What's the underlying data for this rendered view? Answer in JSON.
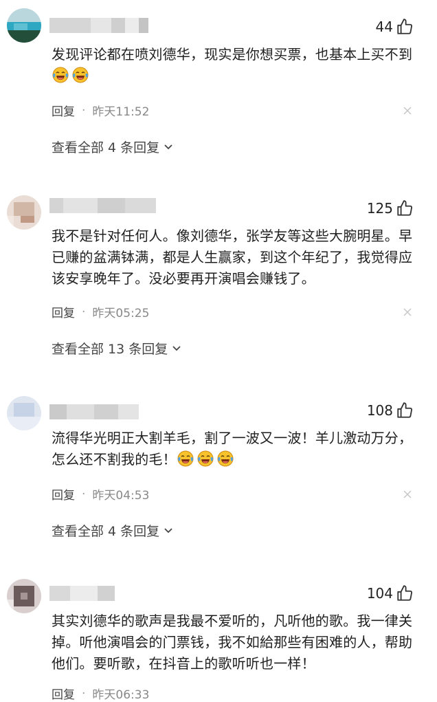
{
  "comments": [
    {
      "likes": "44",
      "text": "发现评论都在喷刘德华，现实是你想买票，也基本上买不到",
      "emoji_count": 2,
      "reply_label": "回复",
      "separator": "·",
      "time": "昨天11:52",
      "view_replies": "查看全部 4 条回复"
    },
    {
      "likes": "125",
      "text": "我不是针对任何人。像刘德华，张学友等这些大腕明星。早已赚的盆满钵满，都是人生赢家，到这个年纪了，我觉得应该安享晚年了。没必要再开演唱会赚钱了。",
      "emoji_count": 0,
      "reply_label": "回复",
      "separator": "·",
      "time": "昨天05:25",
      "view_replies": "查看全部 13 条回复"
    },
    {
      "likes": "108",
      "text": "流得华光明正大割羊毛，割了一波又一波！羊儿激动万分，怎么还不割我的毛！",
      "emoji_count": 3,
      "reply_label": "回复",
      "separator": "·",
      "time": "昨天04:53",
      "view_replies": "查看全部 4 条回复"
    },
    {
      "likes": "104",
      "text": "其实刘德华的歌声是我最不爱听的，凡听他的歌。我一律关掉。听他演唱会的门票钱，我不如給那些有困难的人，帮助他们。要听歌，在抖音上的歌听听也一样！",
      "emoji_count": 0,
      "reply_label": "回复",
      "separator": "·",
      "time": "昨天06:33",
      "view_replies": ""
    }
  ],
  "colors": {
    "text": "#1f1f1f",
    "meta": "#888888",
    "emoji_face": "#f7c22b",
    "emoji_tears": "#4aa3f0"
  },
  "icons": {
    "like": "thumbs-up-icon",
    "close": "close-icon",
    "expand": "chevron-down-icon",
    "emoji": "laughing-crying-emoji-icon"
  }
}
